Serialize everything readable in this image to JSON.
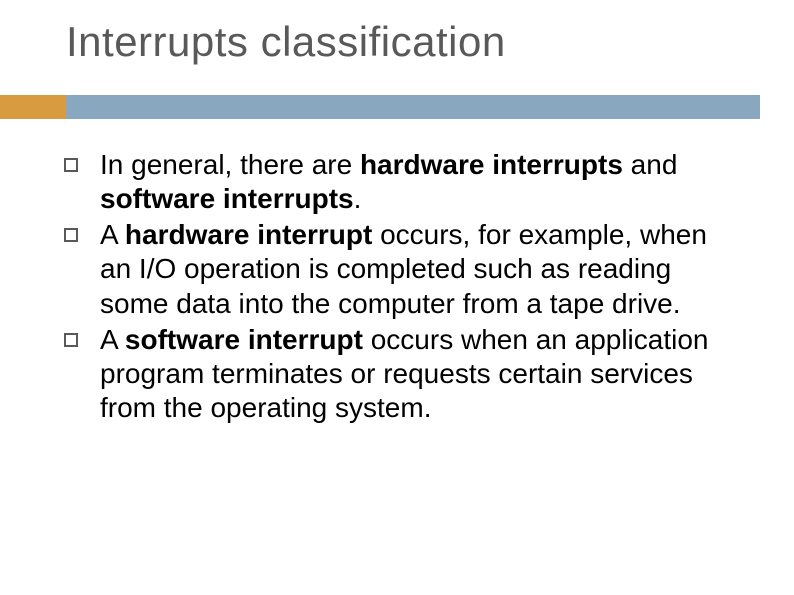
{
  "slide": {
    "title": "Interrupts classification",
    "bullets": [
      {
        "prefix": "In general, there are ",
        "bold1": "hardware interrupts",
        "mid1": " and ",
        "bold2": "software interrupts",
        "suffix": "."
      },
      {
        "prefix": "A ",
        "bold1": "hardware interrupt",
        "mid1": " occurs, for example, when an I/O operation is completed such as reading some data into the computer from a tape drive.",
        "bold2": "",
        "suffix": ""
      },
      {
        "prefix": "A ",
        "bold1": "software interrupt",
        "mid1": " occurs when an application program terminates or requests certain services from the operating system.",
        "bold2": "",
        "suffix": ""
      }
    ]
  },
  "colors": {
    "accent": "#d99b3f",
    "rule": "#8aa7c0",
    "title": "#595959"
  }
}
